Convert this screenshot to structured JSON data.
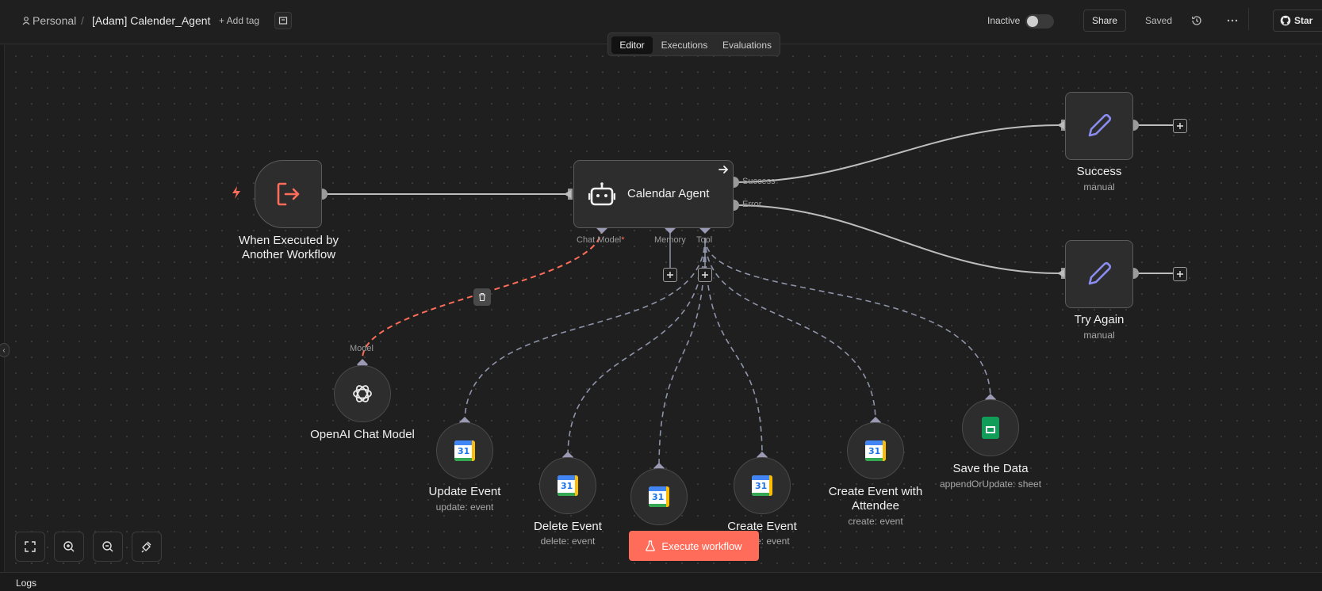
{
  "header": {
    "breadcrumb_personal": "Personal",
    "breadcrumb_separator": "/",
    "workflow_name": "[Adam] Calender_Agent",
    "add_tag": "+ Add tag",
    "status_label": "Inactive",
    "share": "Share",
    "saved": "Saved",
    "star": "Star"
  },
  "tabs": [
    "Editor",
    "Executions",
    "Evaluations"
  ],
  "active_tab": "Editor",
  "nodes": {
    "trigger": {
      "title_line1": "When Executed by",
      "title_line2": "Another Workflow"
    },
    "agent": {
      "title": "Calendar Agent",
      "port_success": "Success",
      "port_error": "Error",
      "port_chat_model": "Chat Model",
      "port_chat_model_required": "*",
      "port_memory": "Memory",
      "port_tool": "Tool"
    },
    "success": {
      "title": "Success",
      "subtitle": "manual"
    },
    "try_again": {
      "title": "Try Again",
      "subtitle": "manual"
    },
    "openai": {
      "title": "OpenAI Chat Model",
      "port_model": "Model"
    },
    "update_event": {
      "title": "Update Event",
      "subtitle": "update: event"
    },
    "delete_event": {
      "title": "Delete Event",
      "subtitle": "delete: event"
    },
    "create_event": {
      "title": "Create Event",
      "subtitle": "create: event"
    },
    "create_event_attendee": {
      "title_line1": "Create Event with",
      "title_line2": "Attendee",
      "subtitle": "create: event"
    },
    "save_data": {
      "title": "Save the Data",
      "subtitle": "appendOrUpdate: sheet"
    }
  },
  "gcal_day": "31",
  "execute_button": "Execute workflow",
  "logs": "Logs",
  "colors": {
    "accent": "#ff6d5a",
    "pen": "#8a8cf0",
    "wire": "#bdbdbd",
    "tool_wire": "#8e93a8"
  }
}
